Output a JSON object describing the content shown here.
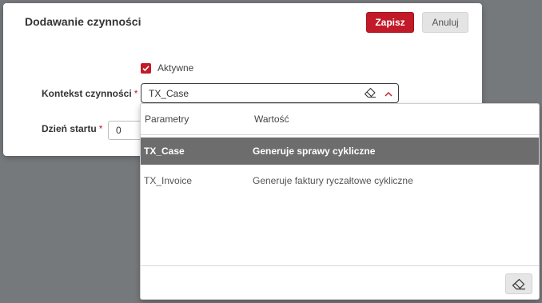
{
  "dialog": {
    "title": "Dodawanie czynności",
    "save_label": "Zapisz",
    "cancel_label": "Anuluj"
  },
  "form": {
    "active_label": "Aktywne",
    "active_checked": true,
    "context_label": "Kontekst czynności",
    "context_value": "TX_Case",
    "start_day_label": "Dzień startu",
    "start_day_value": "0",
    "required_marker": "*"
  },
  "dropdown": {
    "columns": [
      "Parametry",
      "Wartość"
    ],
    "rows": [
      {
        "param": "TX_Case",
        "value": "Generuje sprawy cykliczne",
        "selected": true
      },
      {
        "param": "TX_Invoice",
        "value": "Generuje faktury ryczałtowe cykliczne",
        "selected": false
      }
    ]
  },
  "colors": {
    "accent": "#c21a28",
    "selected_row": "#6d6d6d",
    "backdrop": "#76797c"
  },
  "icons": {
    "eraser": "eraser-icon",
    "chevron": "chevron-up-icon",
    "check": "check-icon"
  }
}
